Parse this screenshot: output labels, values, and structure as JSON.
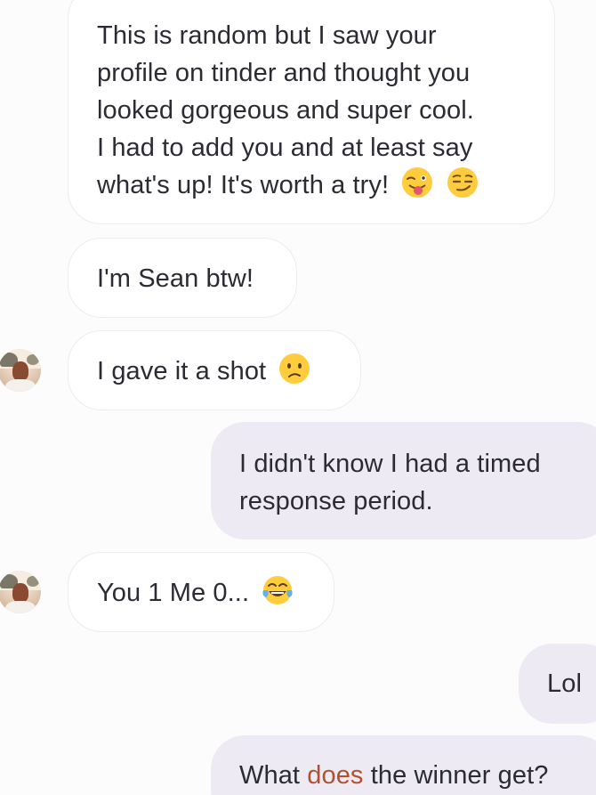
{
  "messages": [
    {
      "direction": "incoming",
      "lines": [
        "This is random but I saw your",
        "profile on tinder and thought you",
        "looked gorgeous and super cool.",
        "I had to add you and at least say",
        "what's up! It's worth a try!"
      ],
      "emojis": [
        "winking-tongue-emoji",
        "smirking-emoji"
      ]
    },
    {
      "direction": "incoming",
      "lines": [
        "I'm Sean btw!"
      ]
    },
    {
      "direction": "incoming",
      "lines": [
        "I gave it a shot"
      ],
      "emojis": [
        "confused-emoji"
      ],
      "avatar": "sender-avatar"
    },
    {
      "direction": "outgoing",
      "lines": [
        "I didn't know I had a timed",
        "response period."
      ]
    },
    {
      "direction": "incoming",
      "lines": [
        "You 1 Me 0..."
      ],
      "emojis": [
        "laughing-tears-emoji"
      ],
      "avatar": "sender-avatar"
    },
    {
      "direction": "outgoing",
      "lines": [
        "Lol"
      ]
    },
    {
      "direction": "outgoing",
      "segments": [
        "What ",
        "does",
        " the winner get?"
      ]
    }
  ],
  "colors": {
    "incoming_bg": "#ffffff",
    "incoming_border": "#ecebef",
    "outgoing_bg": "#eeeaf3",
    "text": "#2b2b33",
    "highlight_text": "#b2502f"
  }
}
